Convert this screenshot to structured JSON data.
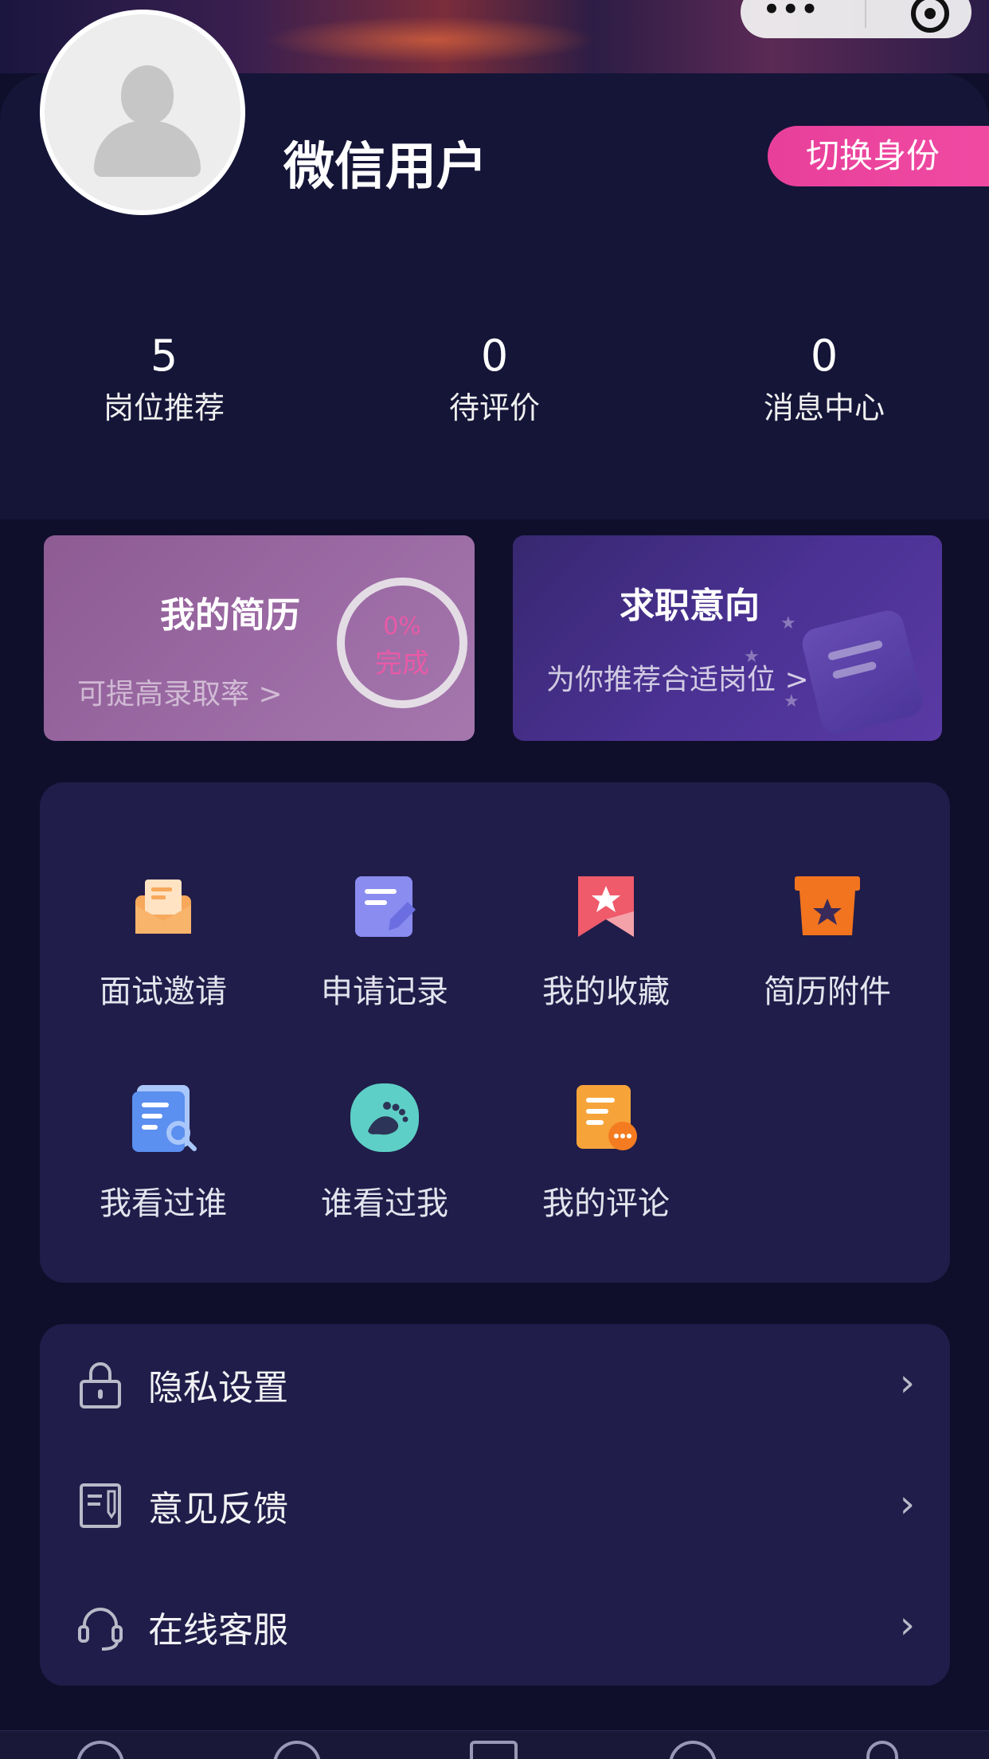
{
  "user": {
    "name": "微信用户",
    "switch_label": "切换身份"
  },
  "stats": [
    {
      "value": "5",
      "label": "岗位推荐"
    },
    {
      "value": "0",
      "label": "待评价"
    },
    {
      "value": "0",
      "label": "消息中心"
    }
  ],
  "cards": {
    "resume": {
      "title": "我的简历",
      "subtitle": "可提高录取率 >",
      "progress_pct": "0%",
      "progress_label": "完成"
    },
    "intent": {
      "title": "求职意向",
      "subtitle": "为你推荐合适岗位 >"
    }
  },
  "features": [
    {
      "label": "面试邀请",
      "icon": "envelope-icon",
      "color": "#f7a85b"
    },
    {
      "label": "申请记录",
      "icon": "edit-document-icon",
      "color": "#8a8cf0"
    },
    {
      "label": "我的收藏",
      "icon": "bookmark-star-icon",
      "color": "#ef5b6b"
    },
    {
      "label": "简历附件",
      "icon": "box-star-icon",
      "color": "#f2741e"
    },
    {
      "label": "我看过谁",
      "icon": "document-search-icon",
      "color": "#5b8ff0"
    },
    {
      "label": "谁看过我",
      "icon": "footprint-icon",
      "color": "#5ecfc6"
    },
    {
      "label": "我的评论",
      "icon": "comment-document-icon",
      "color": "#f6a43a"
    }
  ],
  "settings": [
    {
      "label": "隐私设置",
      "icon": "lock-icon"
    },
    {
      "label": "意见反馈",
      "icon": "feedback-icon"
    },
    {
      "label": "在线客服",
      "icon": "headset-icon"
    }
  ],
  "colors": {
    "background": "#0f0f2b",
    "panel": "#201d4a",
    "accent_pink": "#e8409a"
  }
}
